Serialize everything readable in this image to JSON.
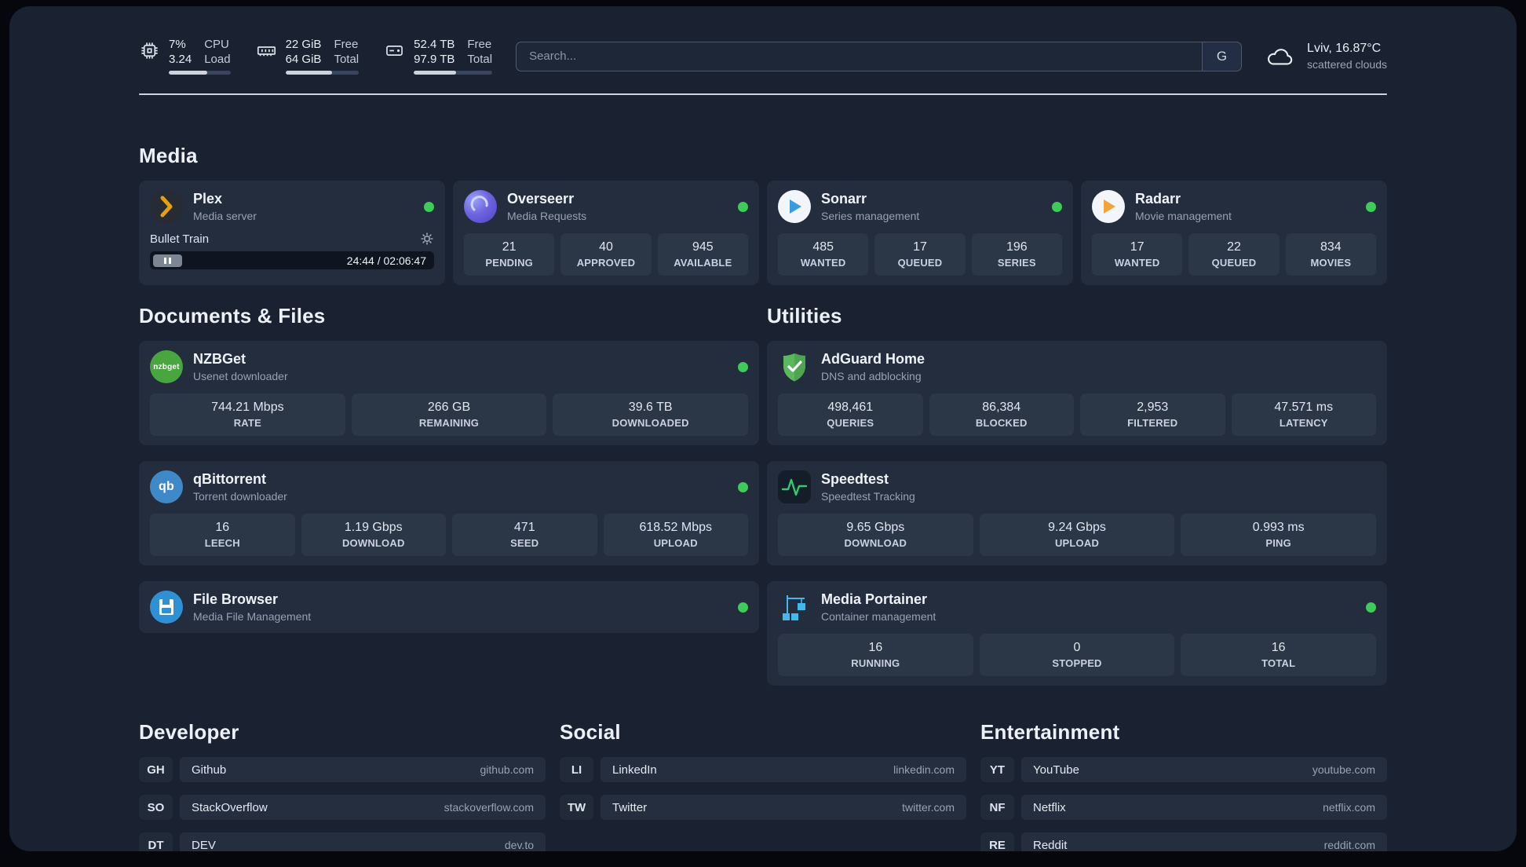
{
  "topbar": {
    "cpu": {
      "value1": "7%",
      "value2": "3.24",
      "label1": "CPU",
      "label2": "Load",
      "bar_percent": 62
    },
    "ram": {
      "value1": "22 GiB",
      "value2": "64 GiB",
      "label1": "Free",
      "label2": "Total",
      "bar_percent": 64
    },
    "disk": {
      "value1": "52.4 TB",
      "value2": "97.9 TB",
      "label1": "Free",
      "label2": "Total",
      "bar_percent": 54
    },
    "search": {
      "placeholder": "Search...",
      "button": "G"
    },
    "weather": {
      "location": "Lviv, 16.87°C",
      "condition": "scattered clouds"
    }
  },
  "media": {
    "heading": "Media",
    "plex": {
      "title": "Plex",
      "subtitle": "Media server",
      "now_playing": {
        "title": "Bullet Train",
        "time": "24:44 / 02:06:47"
      }
    },
    "overseerr": {
      "title": "Overseerr",
      "subtitle": "Media Requests",
      "stats": [
        {
          "value": "21",
          "label": "PENDING"
        },
        {
          "value": "40",
          "label": "APPROVED"
        },
        {
          "value": "945",
          "label": "AVAILABLE"
        }
      ]
    },
    "sonarr": {
      "title": "Sonarr",
      "subtitle": "Series management",
      "stats": [
        {
          "value": "485",
          "label": "WANTED"
        },
        {
          "value": "17",
          "label": "QUEUED"
        },
        {
          "value": "196",
          "label": "SERIES"
        }
      ]
    },
    "radarr": {
      "title": "Radarr",
      "subtitle": "Movie management",
      "stats": [
        {
          "value": "17",
          "label": "WANTED"
        },
        {
          "value": "22",
          "label": "QUEUED"
        },
        {
          "value": "834",
          "label": "MOVIES"
        }
      ]
    }
  },
  "documents": {
    "heading": "Documents & Files",
    "nzbget": {
      "title": "NZBGet",
      "subtitle": "Usenet downloader",
      "icon_text": "nzbget",
      "stats": [
        {
          "value": "744.21 Mbps",
          "label": "RATE"
        },
        {
          "value": "266 GB",
          "label": "REMAINING"
        },
        {
          "value": "39.6 TB",
          "label": "DOWNLOADED"
        }
      ]
    },
    "qbittorrent": {
      "title": "qBittorrent",
      "subtitle": "Torrent downloader",
      "icon_text": "qb",
      "stats": [
        {
          "value": "16",
          "label": "LEECH"
        },
        {
          "value": "1.19 Gbps",
          "label": "DOWNLOAD"
        },
        {
          "value": "471",
          "label": "SEED"
        },
        {
          "value": "618.52 Mbps",
          "label": "UPLOAD"
        }
      ]
    },
    "filebrowser": {
      "title": "File Browser",
      "subtitle": "Media File Management"
    }
  },
  "utilities": {
    "heading": "Utilities",
    "adguard": {
      "title": "AdGuard Home",
      "subtitle": "DNS and adblocking",
      "stats": [
        {
          "value": "498,461",
          "label": "QUERIES"
        },
        {
          "value": "86,384",
          "label": "BLOCKED"
        },
        {
          "value": "2,953",
          "label": "FILTERED"
        },
        {
          "value": "47.571 ms",
          "label": "LATENCY"
        }
      ]
    },
    "speedtest": {
      "title": "Speedtest",
      "subtitle": "Speedtest Tracking",
      "stats": [
        {
          "value": "9.65 Gbps",
          "label": "DOWNLOAD"
        },
        {
          "value": "9.24 Gbps",
          "label": "UPLOAD"
        },
        {
          "value": "0.993 ms",
          "label": "PING"
        }
      ]
    },
    "portainer": {
      "title": "Media Portainer",
      "subtitle": "Container management",
      "stats": [
        {
          "value": "16",
          "label": "RUNNING"
        },
        {
          "value": "0",
          "label": "STOPPED"
        },
        {
          "value": "16",
          "label": "TOTAL"
        }
      ]
    }
  },
  "bookmarks": {
    "developer": {
      "heading": "Developer",
      "items": [
        {
          "abbr": "GH",
          "name": "Github",
          "domain": "github.com"
        },
        {
          "abbr": "SO",
          "name": "StackOverflow",
          "domain": "stackoverflow.com"
        },
        {
          "abbr": "DT",
          "name": "DEV",
          "domain": "dev.to"
        }
      ]
    },
    "social": {
      "heading": "Social",
      "items": [
        {
          "abbr": "LI",
          "name": "LinkedIn",
          "domain": "linkedin.com"
        },
        {
          "abbr": "TW",
          "name": "Twitter",
          "domain": "twitter.com"
        }
      ]
    },
    "entertainment": {
      "heading": "Entertainment",
      "items": [
        {
          "abbr": "YT",
          "name": "YouTube",
          "domain": "youtube.com"
        },
        {
          "abbr": "NF",
          "name": "Netflix",
          "domain": "netflix.com"
        },
        {
          "abbr": "RE",
          "name": "Reddit",
          "domain": "reddit.com"
        }
      ]
    }
  },
  "colors": {
    "status_online": "#3fca5a",
    "plex_gold": "#e5a00d"
  }
}
